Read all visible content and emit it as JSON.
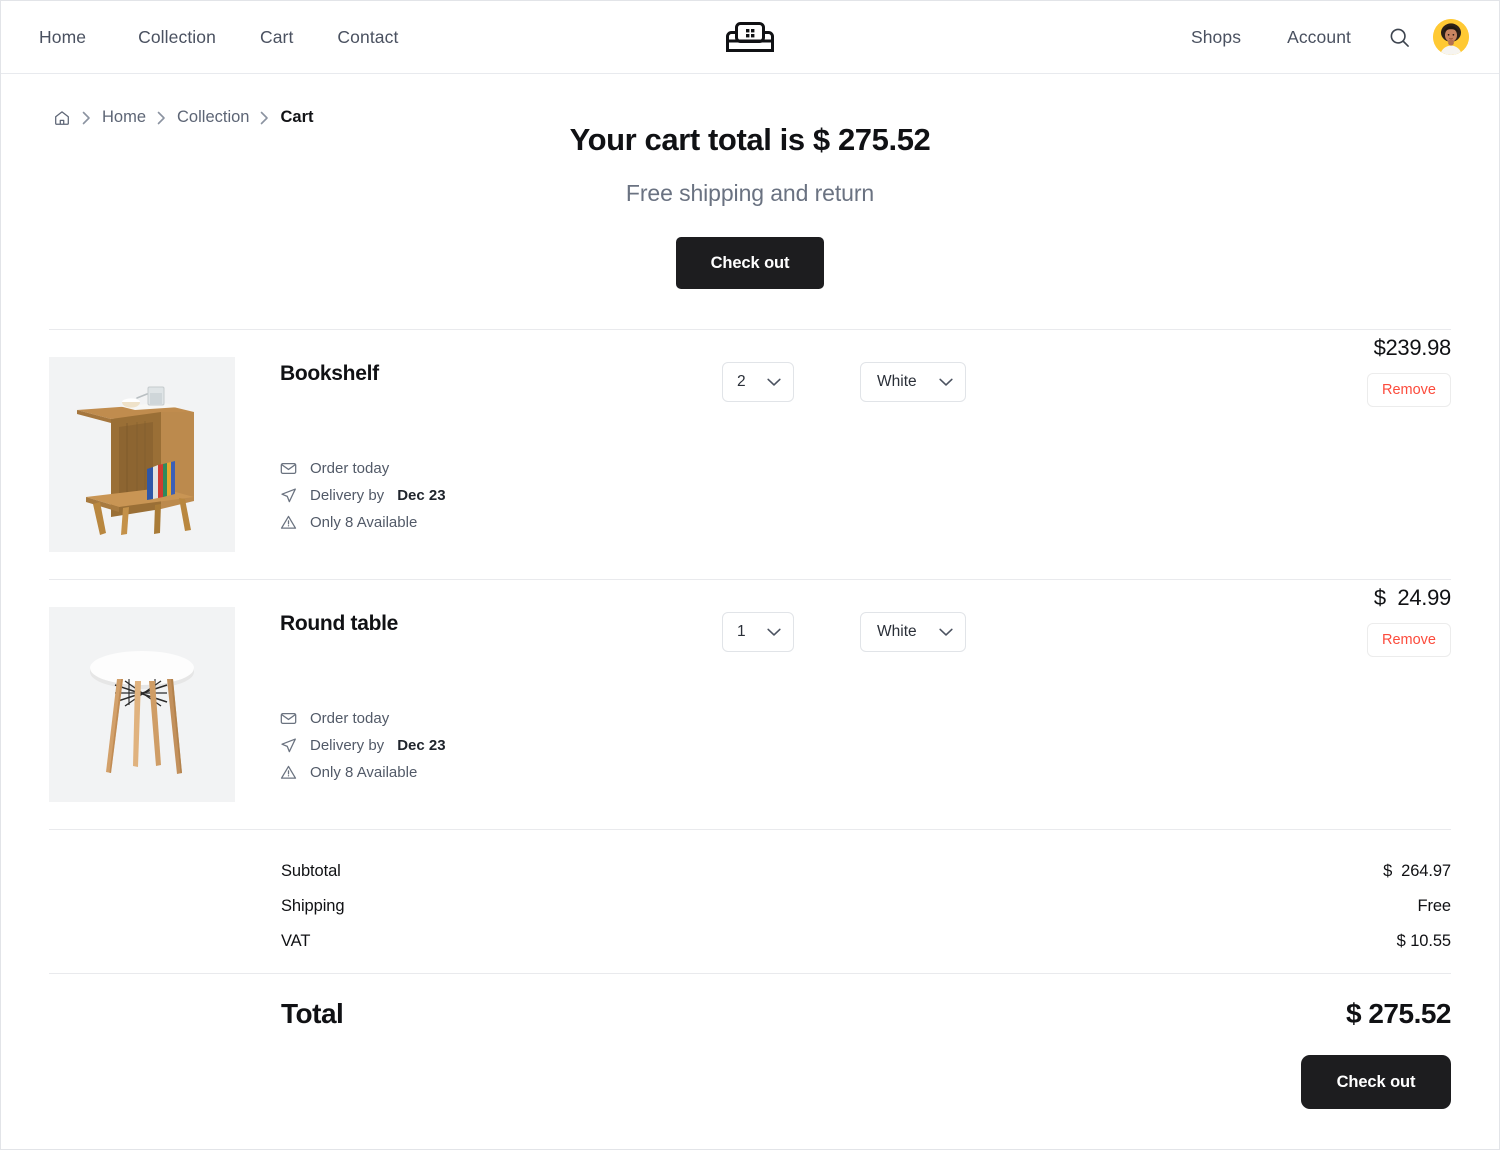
{
  "nav": {
    "left_links": [
      {
        "label": "Home",
        "name": "nav-link-home"
      },
      {
        "label": "Collection",
        "name": "nav-link-collection"
      },
      {
        "label": "Cart",
        "name": "nav-link-cart"
      },
      {
        "label": "Contact",
        "name": "nav-link-contact"
      }
    ],
    "right_links": [
      {
        "label": "Shops",
        "name": "nav-link-shops"
      },
      {
        "label": "Account",
        "name": "nav-link-account"
      }
    ],
    "logo_icon": "sofa-icon",
    "search_icon": "search-icon",
    "avatar_icon": "user-avatar"
  },
  "breadcrumb": {
    "home_icon": "home-icon",
    "separator": "›",
    "items": [
      {
        "label": "Home"
      },
      {
        "label": "Collection"
      },
      {
        "label": "Cart"
      }
    ]
  },
  "header": {
    "title": "Your cart total is $ 275.52",
    "subtitle": "Free shipping and return",
    "checkout_label": "Check out"
  },
  "items": [
    {
      "name": "Bookshelf",
      "thumb": "bookshelf-photo",
      "quantity": "2",
      "color": "White",
      "price": "$239.98",
      "remove_label": "Remove",
      "meta": [
        {
          "icon": "envelope-icon",
          "text": "Order today",
          "bold": ""
        },
        {
          "icon": "paper-plane-icon",
          "text": "Delivery by ",
          "bold": "Dec 23"
        },
        {
          "icon": "warning-triangle-icon",
          "text": "Only 8 Available",
          "bold": ""
        }
      ]
    },
    {
      "name": "Round table",
      "thumb": "round-table-photo",
      "quantity": "1",
      "color": "White",
      "price": "$  24.99",
      "remove_label": "Remove",
      "meta": [
        {
          "icon": "envelope-icon",
          "text": "Order today",
          "bold": ""
        },
        {
          "icon": "paper-plane-icon",
          "text": "Delivery by ",
          "bold": "Dec 23"
        },
        {
          "icon": "warning-triangle-icon",
          "text": "Only 8 Available",
          "bold": ""
        }
      ]
    }
  ],
  "summary": {
    "rows": [
      {
        "label": "Subtotal",
        "value": "$  264.97"
      },
      {
        "label": "Shipping",
        "value": "Free"
      },
      {
        "label": "VAT",
        "value": "$ 10.55"
      }
    ],
    "total_label": "Total",
    "total_value": "$ 275.52",
    "checkout_label": "Check out"
  },
  "colors": {
    "dark_button": "#1d1d1f",
    "remove_red": "#fc4b3c",
    "avatar_yellow": "#ffc933",
    "muted_text": "#6a7281",
    "divider": "#e9eaed"
  }
}
